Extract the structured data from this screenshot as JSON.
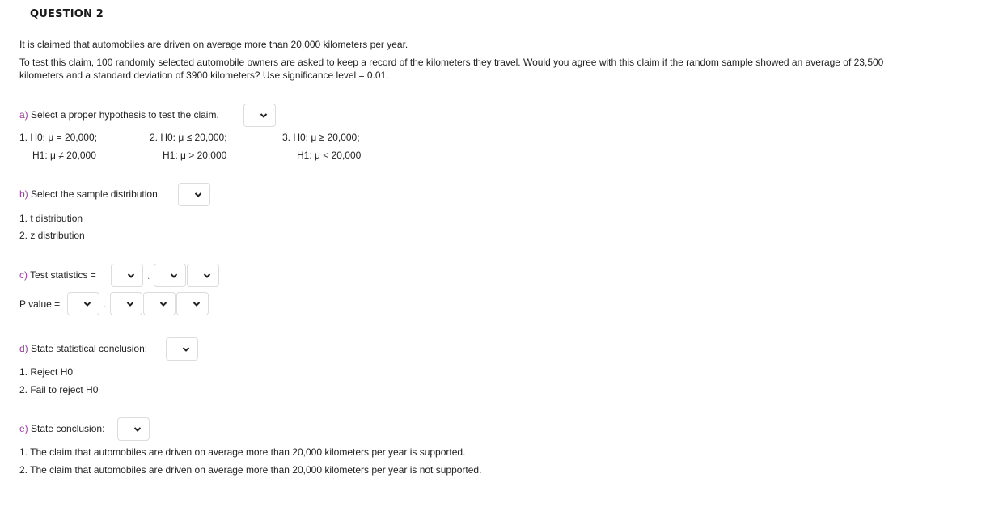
{
  "question": {
    "title": "QUESTION 2",
    "intro": [
      "It is claimed that automobiles are driven on average more than 20,000 kilometers per year.",
      "To test this claim, 100 randomly selected automobile owners are asked to keep a record of the kilometers they travel. Would you agree with this claim if the random sample showed an average of 23,500",
      "kilometers and a standard deviation of 3900 kilometers? Use significance level = 0.01."
    ]
  },
  "part_a": {
    "letter": "a)",
    "prompt": "Select a proper hypothesis to test the claim.",
    "selected": "",
    "options": [
      {
        "h0": "1. H0: μ = 20,000;",
        "h1": "H1: μ ≠ 20,000"
      },
      {
        "h0": "2. H0: μ ≤ 20,000;",
        "h1": "H1: μ > 20,000"
      },
      {
        "h0": "3. H0: μ ≥ 20,000;",
        "h1": "H1: μ < 20,000"
      }
    ]
  },
  "part_b": {
    "letter": "b)",
    "prompt": "Select the sample distribution.",
    "selected": "",
    "options": [
      "1. t distribution",
      "2. z distribution"
    ]
  },
  "part_c": {
    "letter": "c)",
    "test_stat_label": "Test statistics =",
    "p_value_label": "P value =",
    "decimal_point": ".",
    "test_stat_digits": [
      "",
      "",
      ""
    ],
    "p_value_digits": [
      "",
      "",
      "",
      ""
    ]
  },
  "part_d": {
    "letter": "d)",
    "prompt": "State statistical conclusion:",
    "selected": "",
    "options": [
      "1. Reject H0",
      "2. Fail to reject H0"
    ]
  },
  "part_e": {
    "letter": "e)",
    "prompt": "State conclusion:",
    "selected": "",
    "options": [
      "1. The claim that automobiles are driven on average more than 20,000 kilometers per year is supported.",
      "2. The claim that automobiles are driven on average more than 20,000 kilometers per year is not supported."
    ]
  },
  "icons": {
    "dropdown": "chevron-down-icon"
  }
}
